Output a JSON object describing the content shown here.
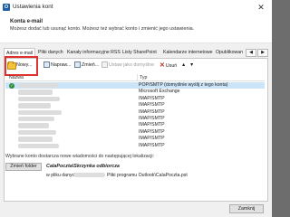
{
  "window": {
    "title": "Ustawienia kont",
    "close_glyph": "✕",
    "app_icon_letter": "O"
  },
  "header": {
    "heading": "Konta e-mail",
    "description": "Możesz dodać lub usunąć konto. Możesz też wybrać konto i zmienić jego ustawienia."
  },
  "tabs": [
    {
      "label": "Adres e-mail",
      "active": true
    },
    {
      "label": "Pliki danych",
      "active": false
    },
    {
      "label": "Kanały informacyjne RSS",
      "active": false
    },
    {
      "label": "Listy SharePoint",
      "active": false
    },
    {
      "label": "Kalendarze internetowe",
      "active": false
    },
    {
      "label": "Opublikowan",
      "active": false
    }
  ],
  "tab_scroll": {
    "left": "◀",
    "right": "▶"
  },
  "toolbar": {
    "new": "Nowy...",
    "repair": "Napraw...",
    "change": "Zmień...",
    "set_default": "Ustaw jako domyślne",
    "remove": "Usuń",
    "up": "▲",
    "down": "▼",
    "dropdown": "▾"
  },
  "columns": {
    "name": "Nazwa",
    "type": "Typ"
  },
  "accounts": [
    {
      "type": "POP/SMTP (domyślnie wyślij z tego konta)",
      "default": true,
      "selected": true
    },
    {
      "type": "Microsoft Exchange",
      "default": false,
      "selected": false
    },
    {
      "type": "IMAP/SMTP",
      "default": false,
      "selected": false
    },
    {
      "type": "IMAP/SMTP",
      "default": false,
      "selected": false
    },
    {
      "type": "IMAP/SMTP",
      "default": false,
      "selected": false
    },
    {
      "type": "IMAP/SMTP",
      "default": false,
      "selected": false
    },
    {
      "type": "IMAP/SMTP",
      "default": false,
      "selected": false
    },
    {
      "type": "IMAP/SMTP",
      "default": false,
      "selected": false
    },
    {
      "type": "IMAP/SMTP",
      "default": false,
      "selected": false
    },
    {
      "type": "IMAP/SMTP",
      "default": false,
      "selected": false
    }
  ],
  "delivery": {
    "note": "Wybrane konto dostarcza nowe wiadomości do następującej lokalizacji:",
    "change_folder": "Zmień folder",
    "store": "CalaPoczta\\Skrzynka odbiorcza",
    "path_label": "w pliku danych",
    "path_value": "Pliki programu Outlook\\CalaPoczta.pst"
  },
  "footer": {
    "close": "Zamknij"
  },
  "colors": {
    "accent_red": "#e0322e",
    "selection": "#cce4f7",
    "default_check": "#2e8b3a"
  }
}
